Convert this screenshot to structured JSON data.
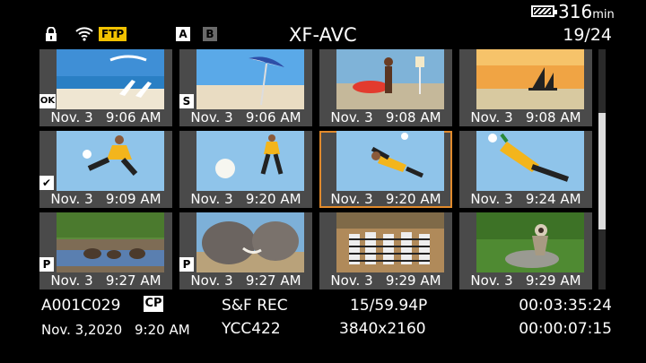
{
  "header": {
    "battery_level": 0.85,
    "remaining_time": "316",
    "remaining_unit": "min",
    "ftp_label": "FTP",
    "slot_a_label": "A",
    "slot_b_label": "B",
    "title": "XF-AVC",
    "clip_counter": "19/24"
  },
  "clips": [
    {
      "caption": "Nov. 3   9:06 AM",
      "badge": "OK",
      "scene": "beach-chairs"
    },
    {
      "caption": "Nov. 3   9:06 AM",
      "badge": "S",
      "scene": "beach-umbrella"
    },
    {
      "caption": "Nov. 3   9:08 AM",
      "badge": "",
      "scene": "surfer"
    },
    {
      "caption": "Nov. 3   9:08 AM",
      "badge": "",
      "scene": "sailboat-sunset"
    },
    {
      "caption": "Nov. 3   9:09 AM",
      "badge": "✔",
      "scene": "soccer-kick"
    },
    {
      "caption": "Nov. 3   9:20 AM",
      "badge": "",
      "scene": "soccer-ball"
    },
    {
      "caption": "Nov. 3   9:20 AM",
      "badge": "",
      "scene": "soccer-bicycle-kick",
      "selected": true
    },
    {
      "caption": "Nov. 3   9:24 AM",
      "badge": "",
      "scene": "goalkeeper"
    },
    {
      "caption": "Nov. 3   9:27 AM",
      "badge": "P",
      "scene": "elephants-lake"
    },
    {
      "caption": "Nov. 3   9:27 AM",
      "badge": "P",
      "scene": "elephants-closeup"
    },
    {
      "caption": "Nov. 3   9:29 AM",
      "badge": "",
      "scene": "zebras"
    },
    {
      "caption": "Nov. 3   9:29 AM",
      "badge": "",
      "scene": "monkey"
    }
  ],
  "footer": {
    "clip_name": "A001C029",
    "cp_label": "CP",
    "rec_mode": "S&F REC",
    "frame_rate": "15/59.94P",
    "timecode": "00:03:35:24",
    "date": "Nov. 3,2020",
    "time": "9:20 AM",
    "color_format": "YCC422",
    "resolution": "3840x2160",
    "duration": "00:00:07:15"
  },
  "colors": {
    "selection": "#e08a2c",
    "ftp_badge": "#f2c200",
    "cell_bg": "#4a4a4a"
  },
  "scroll": {
    "position_fraction": 0.5
  }
}
